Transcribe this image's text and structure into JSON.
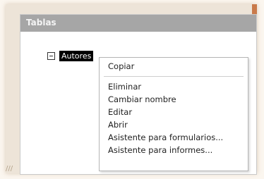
{
  "panel": {
    "title": "Tablas"
  },
  "tree": {
    "item_label": "Autores"
  },
  "menu": {
    "items": [
      "Copiar",
      "Eliminar",
      "Cambiar nombre",
      "Editar",
      "Abrir",
      "Asistente para formularios...",
      "Asistente para informes..."
    ]
  },
  "icons": {
    "expander": "collapse-box-icon",
    "corner": "resize-grip-icon"
  },
  "colors": {
    "header": "#a6a6a6",
    "selection": "#000000",
    "accent": "#c97a4a"
  }
}
